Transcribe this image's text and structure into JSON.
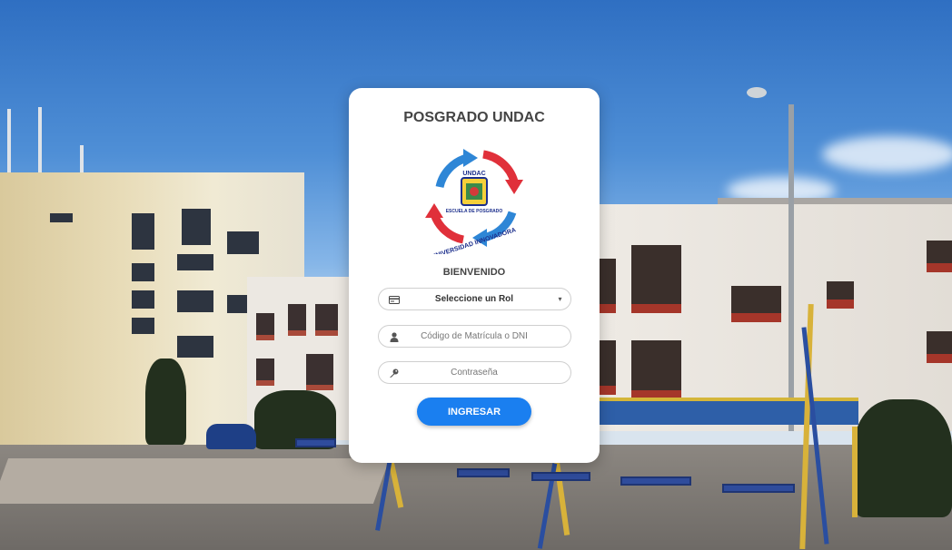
{
  "header": {
    "title": "POSGRADO UNDAC"
  },
  "logo": {
    "top_text": "UNDAC",
    "arc_inner": "ESCUELA DE POSGRADO",
    "arc_outer": "UNIVERSIDAD INNOVADORA",
    "colors": {
      "blue": "#2e86d6",
      "red": "#e0303a",
      "navy": "#1c2f8c"
    }
  },
  "form": {
    "welcome": "BIENVENIDO",
    "role": {
      "selected": "Seleccione un Rol",
      "options": [
        "Seleccione un Rol"
      ]
    },
    "code": {
      "placeholder": "Código de Matrícula o DNI",
      "value": ""
    },
    "password": {
      "placeholder": "Contraseña",
      "value": ""
    },
    "submit_label": "INGRESAR"
  },
  "icons": {
    "role": "id-card-icon",
    "code": "user-icon",
    "password": "key-icon",
    "select": "chevron-down-icon"
  },
  "colors": {
    "accent": "#1a7ff0",
    "card": "#ffffff",
    "text": "#444444"
  }
}
